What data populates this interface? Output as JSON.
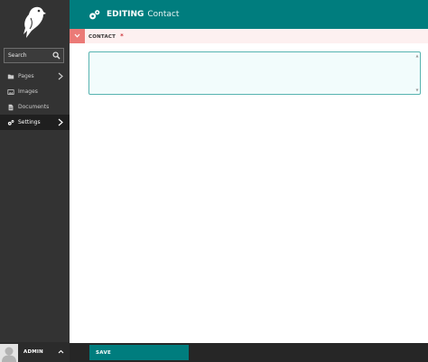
{
  "sidebar": {
    "search": {
      "placeholder": "Search"
    },
    "items": [
      {
        "label": "Pages",
        "icon": "folder-icon",
        "has_children": true
      },
      {
        "label": "Images",
        "icon": "image-icon",
        "has_children": false
      },
      {
        "label": "Documents",
        "icon": "document-icon",
        "has_children": false
      },
      {
        "label": "Settings",
        "icon": "cogs-icon",
        "has_children": true,
        "active": true
      }
    ],
    "account": {
      "name": "ADMIN"
    }
  },
  "header": {
    "action": "EDITING",
    "subject": "Contact"
  },
  "field": {
    "label": "CONTACT",
    "required_marker": "*"
  },
  "footer": {
    "save_label": "SAVE"
  },
  "colors": {
    "sidebar_bg": "#333333",
    "header_teal": "#007d7e",
    "field_toggle": "#eb7a77",
    "field_strip": "#fdf0f0",
    "required": "#cd3238"
  }
}
